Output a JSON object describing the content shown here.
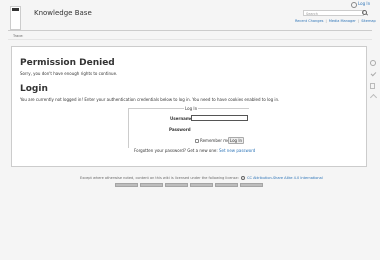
{
  "header": {
    "site_title": "Knowledge Base",
    "login_link": "Log In",
    "search_placeholder": "Search",
    "tools": [
      "Recent Changes",
      "Media Manager",
      "Sitemap"
    ]
  },
  "breadcrumb": {
    "trace": "Trace:"
  },
  "page": {
    "denied_title": "Permission Denied",
    "denied_text": "Sorry, you don't have enough rights to continue.",
    "login_title": "Login",
    "login_text": "You are currently not logged in! Enter your authentication credentials below to log in. You need to have cookies enabled to log in.",
    "form": {
      "legend": "Log In",
      "username_label": "Username",
      "password_label": "Password",
      "remember_label": "Remember me",
      "login_button": "Log In",
      "forgot_text": "Forgotten your password? Get a new one:",
      "forgot_link": "Set new password"
    }
  },
  "footer": {
    "license_text": "Except where otherwise noted, content on this wiki is licensed under the following license:",
    "license_link": "CC Attribution-Share Alike 4.0 International"
  },
  "colors": {
    "link": "#2b73b7",
    "page_bg": "#f5f5f5"
  }
}
